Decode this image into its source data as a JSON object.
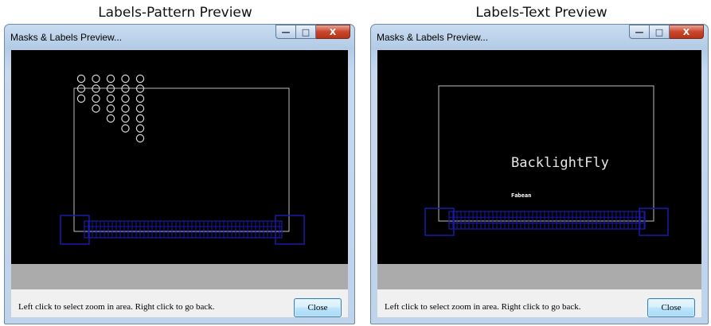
{
  "captions": {
    "left": "Labels-Pattern Preview",
    "right": "Labels-Text Preview"
  },
  "left_window": {
    "title": "Masks & Labels Preview...",
    "status": "Left click to select zoom in area. Right click to go back.",
    "close_label": "Close",
    "pattern_rows": [
      5,
      5,
      5,
      4,
      3,
      2,
      1
    ]
  },
  "right_window": {
    "title": "Masks & Labels Preview...",
    "status": "Left click to select zoom in area. Right click to go back.",
    "close_label": "Close",
    "label_large": "BacklightFly",
    "label_small": "Fabean"
  },
  "controls": {
    "minimize_glyph": "—",
    "maximize_glyph": "□",
    "close_glyph": "X"
  },
  "colors": {
    "canvas": "#000000",
    "outline": "#bdbdbd",
    "mask": "#1a1aa8",
    "band": "#ababab"
  }
}
